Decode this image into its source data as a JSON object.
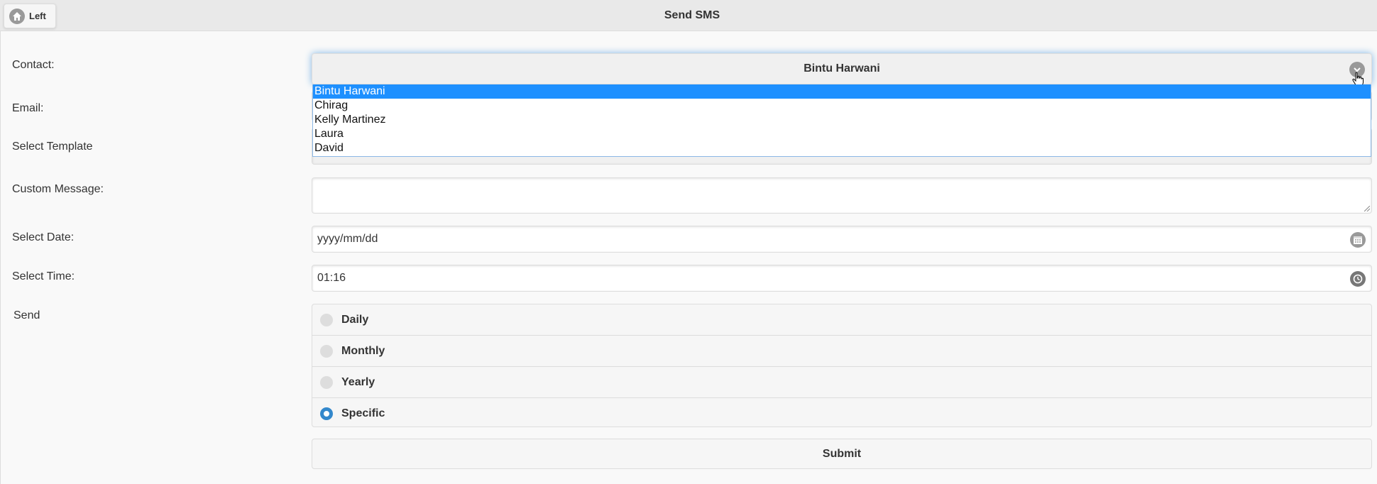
{
  "header": {
    "back_label": "Left",
    "title": "Send SMS"
  },
  "form": {
    "contact_label": "Contact:",
    "contact_selected": "Bintu Harwani",
    "contact_options": [
      "Bintu Harwani",
      "Chirag",
      "Kelly Martinez",
      "Laura",
      "David"
    ],
    "email_label": "Email:",
    "template_label": "Select Template",
    "custom_message_label": "Custom Message:",
    "custom_message_value": "",
    "date_label": "Select Date:",
    "date_value": "yyyy/mm/dd",
    "time_label": "Select Time:",
    "time_value": "01:16",
    "send_label": "Send",
    "send_options": [
      "Daily",
      "Monthly",
      "Yearly",
      "Specific"
    ],
    "send_selected": "Specific",
    "submit_label": "Submit"
  },
  "icons": {
    "back": "home-icon",
    "select": "chevron-down-icon",
    "date": "calendar-icon",
    "time": "clock-icon"
  },
  "colors": {
    "highlight": "#1e90ff",
    "radio_active": "#3388cc"
  }
}
